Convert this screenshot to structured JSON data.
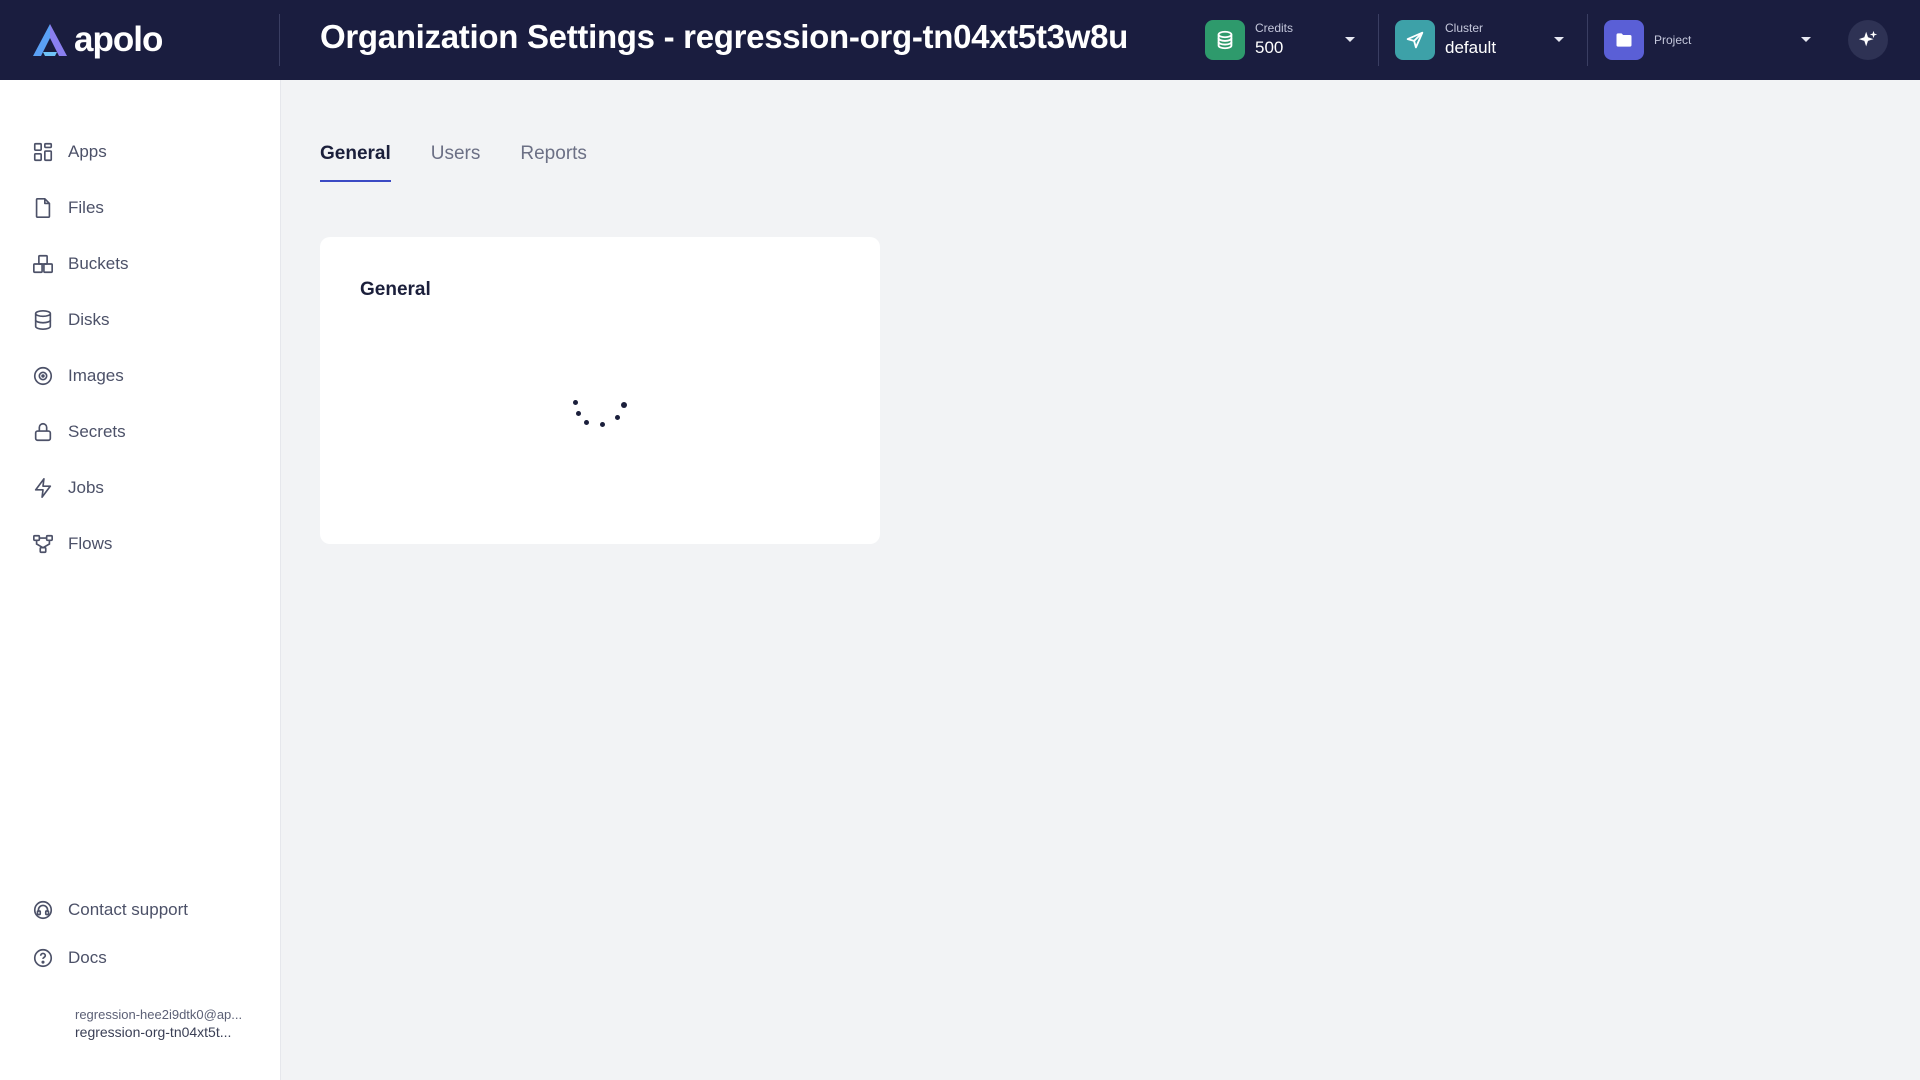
{
  "app": {
    "brand": "apolo",
    "page_title": "Organization Settings - regression-org-tn04xt5t3w8u"
  },
  "header": {
    "credits": {
      "caption": "Credits",
      "value": "500",
      "icon": "coins-icon",
      "color": "#2e9a6c"
    },
    "cluster": {
      "caption": "Cluster",
      "value": "default",
      "icon": "send-icon",
      "color": "#3da1a8"
    },
    "project": {
      "caption": "Project",
      "value": "",
      "icon": "folder-icon",
      "color": "#5a5fd6"
    },
    "ai_icon": "sparkle-icon"
  },
  "sidebar": {
    "items": [
      {
        "label": "Apps",
        "icon": "apps-icon"
      },
      {
        "label": "Files",
        "icon": "file-icon"
      },
      {
        "label": "Buckets",
        "icon": "buckets-icon"
      },
      {
        "label": "Disks",
        "icon": "database-icon"
      },
      {
        "label": "Images",
        "icon": "image-icon"
      },
      {
        "label": "Secrets",
        "icon": "lock-icon"
      },
      {
        "label": "Jobs",
        "icon": "lightning-icon"
      },
      {
        "label": "Flows",
        "icon": "flows-icon"
      }
    ],
    "footer": [
      {
        "label": "Contact support",
        "icon": "headset-icon"
      },
      {
        "label": "Docs",
        "icon": "help-icon"
      }
    ],
    "user": {
      "email": "regression-hee2i9dtk0@ap...",
      "org": "regression-org-tn04xt5t..."
    }
  },
  "main": {
    "tabs": [
      {
        "label": "General",
        "active": true
      },
      {
        "label": "Users",
        "active": false
      },
      {
        "label": "Reports",
        "active": false
      }
    ],
    "card": {
      "title": "General",
      "state": "loading"
    }
  },
  "colors": {
    "header_bg": "#1a1d3f",
    "accent": "#3b4ac4",
    "page_bg": "#f2f3f5"
  }
}
